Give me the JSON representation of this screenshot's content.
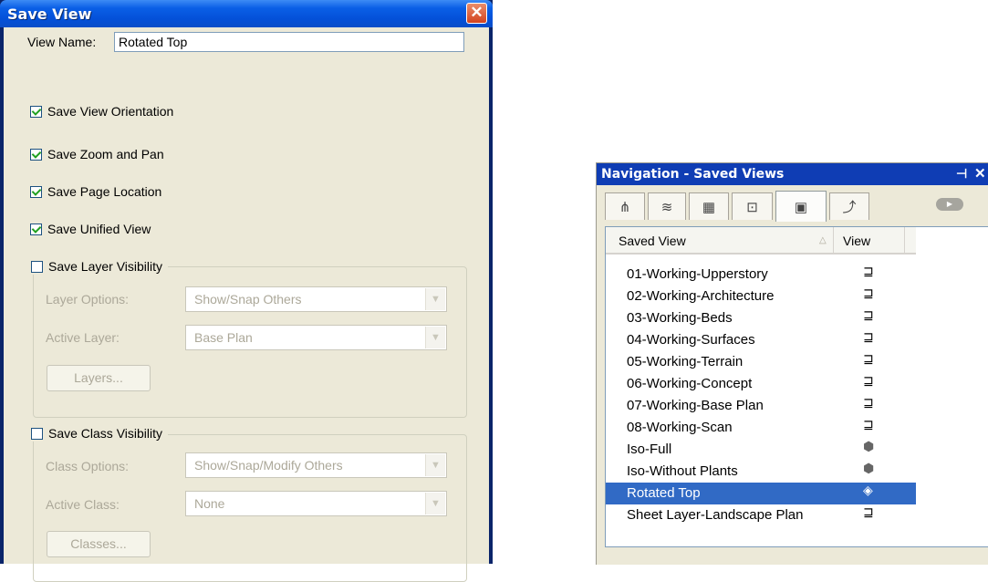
{
  "save_view": {
    "title": "Save View",
    "close_symbol": "✕",
    "view_name_label": "View Name:",
    "view_name_value": "Rotated Top",
    "checkboxes": [
      {
        "label": "Save View Orientation",
        "checked": true
      },
      {
        "label": "Save Zoom and Pan",
        "checked": true
      },
      {
        "label": "Save Page Location",
        "checked": true
      },
      {
        "label": "Save Unified View",
        "checked": true
      }
    ],
    "layer_group": {
      "checkbox_label": "Save Layer Visibility",
      "checked": false,
      "options_label": "Layer Options:",
      "options_value": "Show/Snap Others",
      "active_label": "Active Layer:",
      "active_value": "Base Plan",
      "button_label": "Layers..."
    },
    "class_group": {
      "checkbox_label": "Save Class Visibility",
      "checked": false,
      "options_label": "Class Options:",
      "options_value": "Show/Snap/Modify Others",
      "active_label": "Active Class:",
      "active_value": "None",
      "button_label": "Classes..."
    }
  },
  "navigation": {
    "title": "Navigation - Saved Views",
    "pin_symbol": "⊣",
    "close_symbol": "✕",
    "tabs": [
      {
        "icon": "hierarchy-icon",
        "glyph": "⋔"
      },
      {
        "icon": "layers-icon",
        "glyph": "≋"
      },
      {
        "icon": "viewports-icon",
        "glyph": "▦"
      },
      {
        "icon": "sheets-icon",
        "glyph": "⊡"
      },
      {
        "icon": "saved-views-icon",
        "glyph": "▣",
        "active": true
      },
      {
        "icon": "references-icon",
        "glyph": "⤴"
      }
    ],
    "columns": {
      "saved_view": "Saved View",
      "view": "View"
    },
    "rows": [
      {
        "name": "01-Working-Upperstory",
        "icon": "plan-view-icon",
        "glyph": "⊒"
      },
      {
        "name": "02-Working-Architecture",
        "icon": "plan-view-icon",
        "glyph": "⊒"
      },
      {
        "name": "03-Working-Beds",
        "icon": "plan-view-icon",
        "glyph": "⊒"
      },
      {
        "name": "04-Working-Surfaces",
        "icon": "plan-view-icon",
        "glyph": "⊒"
      },
      {
        "name": "05-Working-Terrain",
        "icon": "plan-view-icon",
        "glyph": "⊒"
      },
      {
        "name": "06-Working-Concept",
        "icon": "plan-view-icon",
        "glyph": "⊒"
      },
      {
        "name": "07-Working-Base Plan",
        "icon": "plan-view-icon",
        "glyph": "⊒"
      },
      {
        "name": "08-Working-Scan",
        "icon": "plan-view-icon",
        "glyph": "⊒"
      },
      {
        "name": "Iso-Full",
        "icon": "iso-view-icon",
        "glyph": "⬢"
      },
      {
        "name": "Iso-Without Plants",
        "icon": "iso-view-icon",
        "glyph": "⬢"
      },
      {
        "name": "Rotated Top",
        "icon": "rotated-view-icon",
        "glyph": "◈",
        "selected": true
      },
      {
        "name": "Sheet Layer-Landscape Plan",
        "icon": "plan-view-icon",
        "glyph": "⊒"
      }
    ]
  },
  "colors": {
    "selection": "#316ac5",
    "title_bar": "#0a5fe6",
    "nav_title": "#0f3db4",
    "dialog_face": "#ece9d8"
  }
}
